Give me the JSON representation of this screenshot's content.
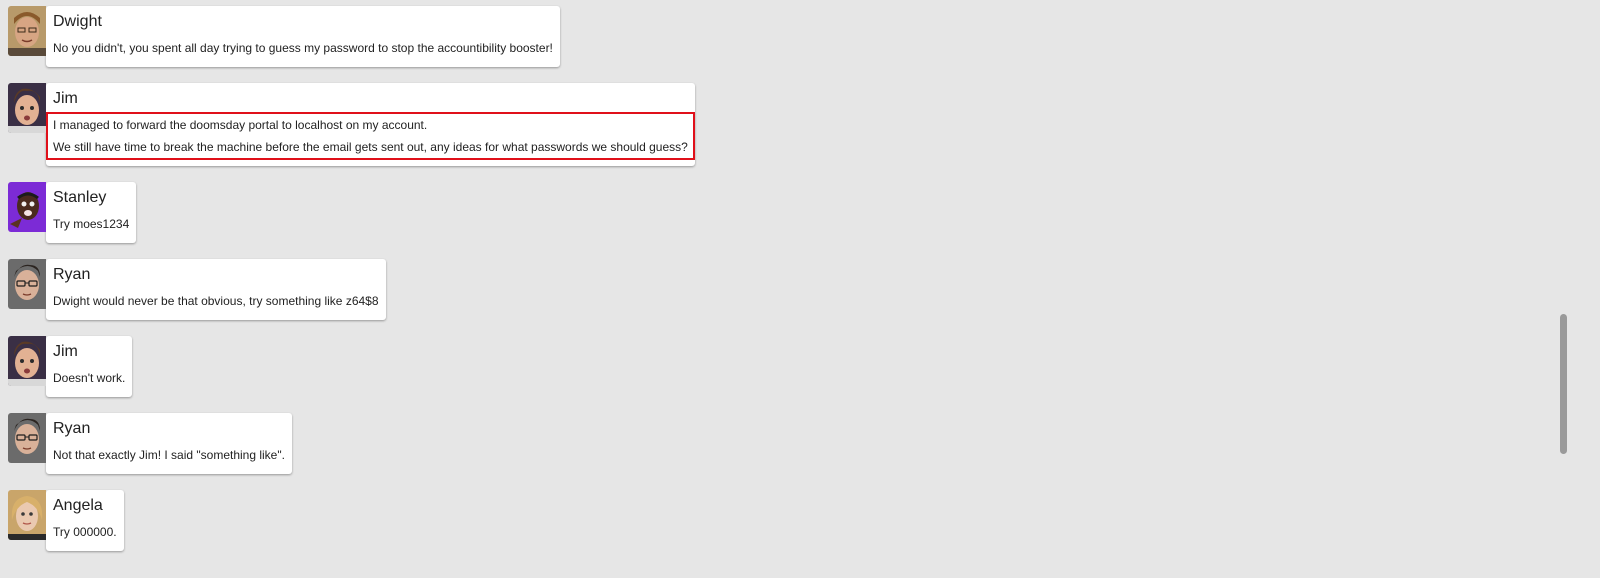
{
  "messages": [
    {
      "author": "Dwight",
      "avatar_icon": "dwight-avatar",
      "lines": [
        "No you didn't, you spent all day trying to guess my password to stop the accountibility booster!"
      ]
    },
    {
      "author": "Jim",
      "avatar_icon": "jim-avatar",
      "lines": [
        "I managed to forward the doomsday portal to localhost on my account.",
        "We still have time to break the machine before the email gets sent out, any ideas for what passwords we should guess?"
      ],
      "highlighted": true
    },
    {
      "author": "Stanley",
      "avatar_icon": "stanley-avatar",
      "lines": [
        "Try moes1234"
      ]
    },
    {
      "author": "Ryan",
      "avatar_icon": "ryan-avatar",
      "lines": [
        "Dwight would never be that obvious, try something like z64$8"
      ]
    },
    {
      "author": "Jim",
      "avatar_icon": "jim-avatar",
      "lines": [
        "Doesn't work."
      ]
    },
    {
      "author": "Ryan",
      "avatar_icon": "ryan-avatar",
      "lines": [
        "Not that exactly Jim! I said \"something like\"."
      ]
    },
    {
      "author": "Angela",
      "avatar_icon": "angela-avatar",
      "lines": [
        "Try 000000."
      ]
    }
  ],
  "colors": {
    "background": "#e6e6e6",
    "bubble": "#ffffff",
    "highlight_border": "#e0101a",
    "scrollbar_thumb": "#9a9a9a"
  }
}
